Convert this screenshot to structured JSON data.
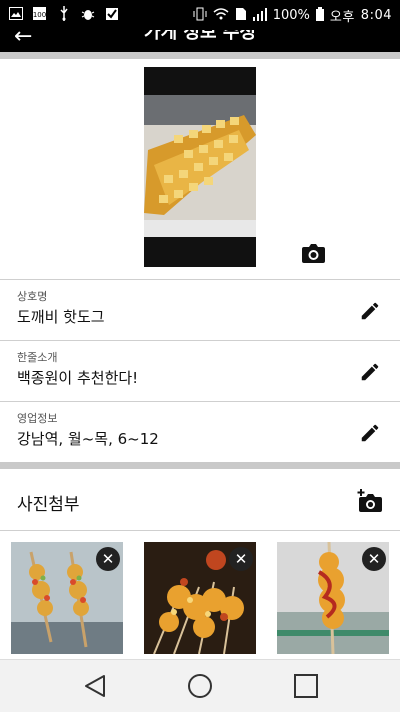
{
  "status_bar": {
    "battery": "100%",
    "ampm": "오후",
    "time": "8:04",
    "icons": [
      "gallery-icon",
      "100-icon",
      "usb-icon",
      "bug-icon",
      "check-flag-icon",
      "vibrate-icon",
      "wifi-icon",
      "sim-icon",
      "signal-icon",
      "battery-icon"
    ]
  },
  "app_bar": {
    "title": "가게 정보 수정",
    "back_icon": "back-arrow-icon"
  },
  "hero": {
    "camera_icon": "camera-icon"
  },
  "fields": [
    {
      "label": "상호명",
      "value": "도깨비 핫도그"
    },
    {
      "label": "한줄소개",
      "value": "백종원이 추천한다!"
    },
    {
      "label": "영업정보",
      "value": "강남역, 월~목, 6~12"
    }
  ],
  "attachment": {
    "label": "사진첨부",
    "add_icon": "add-photo-icon"
  },
  "thumbnails": [
    {
      "remove_icon": "close-icon"
    },
    {
      "remove_icon": "close-icon"
    },
    {
      "remove_icon": "close-icon"
    }
  ],
  "nav": {
    "icons": [
      "back-triangle-icon",
      "home-circle-icon",
      "recents-square-icon"
    ]
  }
}
